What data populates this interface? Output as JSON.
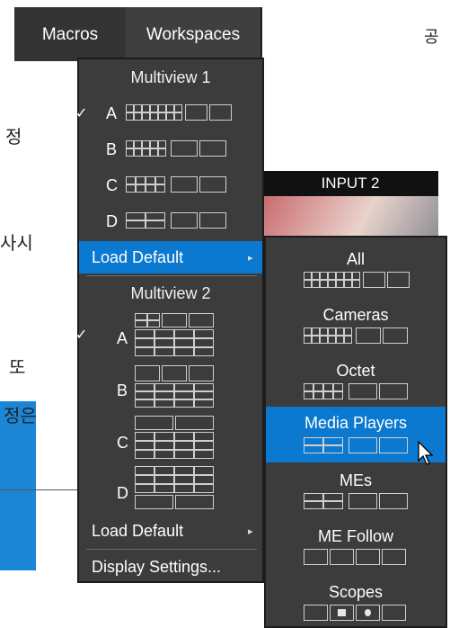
{
  "background_text": {
    "top_right_fragment": "공",
    "line_a": "정",
    "line_b": "사시",
    "line_c": "또",
    "line_d": "정은"
  },
  "menubar": {
    "macros_label": "Macros",
    "workspaces_label": "Workspaces"
  },
  "multiview_menu": {
    "mv1_header": "Multiview 1",
    "mv1_items": [
      {
        "letter": "A",
        "checked": true
      },
      {
        "letter": "B",
        "checked": false
      },
      {
        "letter": "C",
        "checked": false
      },
      {
        "letter": "D",
        "checked": false
      }
    ],
    "load_default_1": "Load Default",
    "mv2_header": "Multiview 2",
    "mv2_items": [
      {
        "letter": "A",
        "checked": true
      },
      {
        "letter": "B",
        "checked": false
      },
      {
        "letter": "C",
        "checked": false
      },
      {
        "letter": "D",
        "checked": false
      }
    ],
    "load_default_2": "Load Default",
    "display_settings": "Display Settings..."
  },
  "check_mark": "✓",
  "submenu_arrow": "▸",
  "preview": {
    "label": "INPUT 2"
  },
  "load_default_submenu": {
    "options": [
      "All",
      "Cameras",
      "Octet",
      "Media Players",
      "MEs",
      "ME Follow",
      "Scopes"
    ],
    "highlighted": "Media Players"
  },
  "colors": {
    "menu_bg": "#3c3c3c",
    "highlight": "#0c79d0",
    "callout_blue": "#1b86d6"
  }
}
